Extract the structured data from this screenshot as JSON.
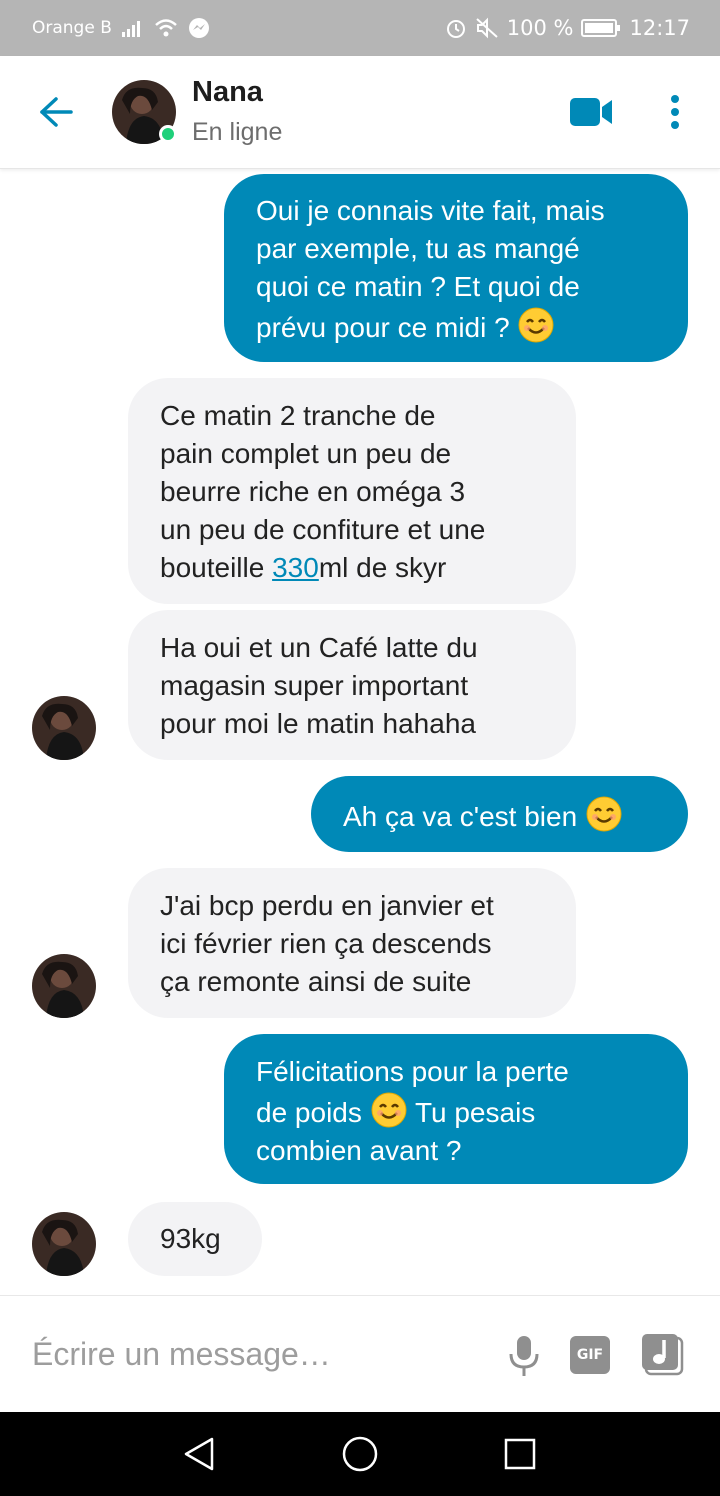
{
  "status_bar": {
    "carrier": "Orange B",
    "battery": "100 %",
    "time": "12:17"
  },
  "header": {
    "contact_name": "Nana",
    "contact_status": "En ligne",
    "accent_color": "#0089b7",
    "online_color": "#1fd07a"
  },
  "messages": [
    {
      "direction": "outgoing",
      "lines": [
        "Oui je connais vite fait, mais",
        "par exemple, tu as mangé",
        "quoi ce matin ? Et quoi de",
        "prévu pour ce midi ?"
      ],
      "emoji": "smiling-face-emoji"
    },
    {
      "direction": "incoming",
      "lines": [
        "Ce matin 2 tranche de",
        "pain complet un peu de",
        "beurre riche en oméga 3",
        "un peu de confiture et une",
        "bouteille"
      ],
      "link_text": "330",
      "after_link": "ml de skyr"
    },
    {
      "direction": "incoming",
      "lines": [
        "Ha oui et un Café latte du",
        "magasin super important",
        "pour moi le matin hahaha"
      ]
    },
    {
      "direction": "outgoing",
      "lines": [
        "Ah ça va c'est bien"
      ],
      "emoji": "smiling-face-emoji"
    },
    {
      "direction": "incoming",
      "lines": [
        "J'ai bcp perdu en janvier et",
        "ici février rien ça descends",
        "ça remonte ainsi de suite"
      ]
    },
    {
      "direction": "outgoing",
      "lines": [
        "Félicitations pour la perte",
        "de poids",
        "Tu pesais",
        "combien avant ?"
      ],
      "emoji": "smiling-face-emoji"
    },
    {
      "direction": "incoming",
      "lines": [
        "93kg"
      ]
    }
  ],
  "composer": {
    "placeholder": "Écrire un message…",
    "gif_label": "GIF"
  },
  "icons": {
    "back": "arrow-left-icon",
    "video": "video-camera-icon",
    "more": "more-vertical-icon",
    "mic": "microphone-icon",
    "music": "music-note-icon"
  }
}
